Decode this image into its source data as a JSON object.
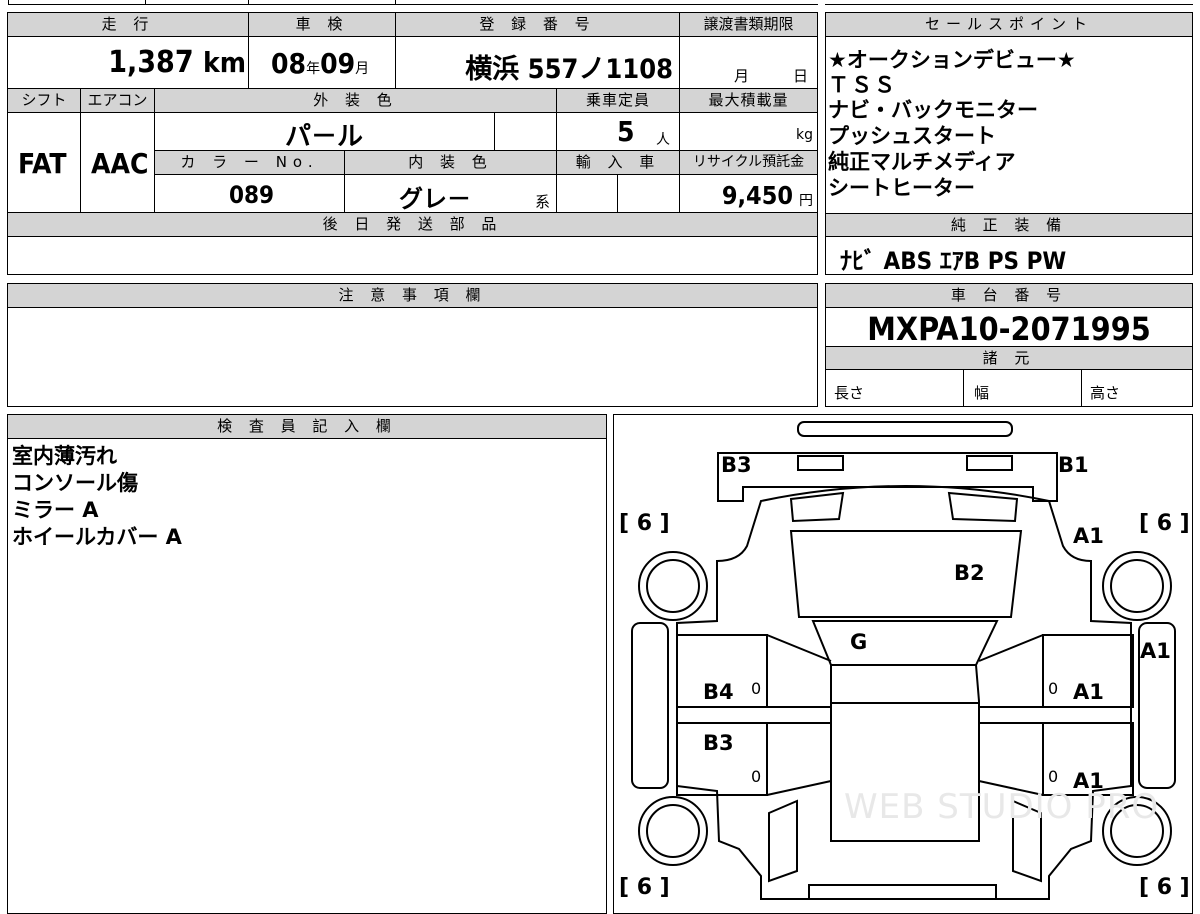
{
  "top_left": {
    "headers": {
      "mileage": "走 行",
      "inspection": "車 検",
      "registration": "登 録 番 号",
      "deadline": "譲渡書類期限",
      "shift": "シフト",
      "aircon": "エアコン",
      "exterior_color": "外 装 色",
      "capacity": "乗車定員",
      "max_load": "最大積載量",
      "color_no": "カ ラ ー No.",
      "interior_color": "内 装 色",
      "import": "輸 入 車",
      "recycle": "リサイクル預託金",
      "later_parts": "後 日 発 送 部 品",
      "notes": "注 意 事 項 欄"
    },
    "mileage_value": "1,387",
    "mileage_unit": "km",
    "inspection_year": "08",
    "year_unit": "年",
    "inspection_month": "09",
    "month_unit": "月",
    "registration_number": "横浜 557ノ1108",
    "deadline_month": "月",
    "deadline_day": "日",
    "shift_value": "FAT",
    "aircon_value": "AAC",
    "exterior_color_value": "パ－ル",
    "capacity_value": "5",
    "capacity_unit": "人",
    "max_load_unit": "kg",
    "color_no_value": "089",
    "interior_color_value": "グレ－",
    "interior_suffix": "系",
    "recycle_value": "9,450",
    "recycle_unit": "円"
  },
  "sales_points": {
    "header": "セールスポイント",
    "lines": [
      "★オークションデビュー★",
      "ＴＳＳ",
      "ナビ・バックモニター",
      "プッシュスタート",
      "純正マルチメディア",
      "シートヒーター"
    ]
  },
  "equipment": {
    "header": "純 正 装 備",
    "value": "ﾅﾋﾞ ABS ｴｱB PS PW"
  },
  "chassis": {
    "header": "車 台 番 号",
    "value": "MXPA10-2071995"
  },
  "specs": {
    "header": "諸 元",
    "length": "長さ",
    "width": "幅",
    "height": "高さ"
  },
  "inspector": {
    "header": "検 査 員 記 入 欄",
    "lines": [
      "室内薄汚れ",
      "コンソール傷",
      "ミラー A",
      "ホイールカバー A"
    ]
  },
  "diagram": {
    "tire_label": "[ 6 ]",
    "labels": {
      "rear_left": "B3",
      "rear_right": "B1",
      "front_right_fender": "A1",
      "hood": "B2",
      "windshield": "G",
      "right_side": "A1",
      "left_front_door": "B4",
      "right_front_door": "A1",
      "left_rear_door": "B3",
      "right_rear_door": "A1"
    },
    "door_zero": "0",
    "watermark": "WEB STUDIO PRO"
  }
}
